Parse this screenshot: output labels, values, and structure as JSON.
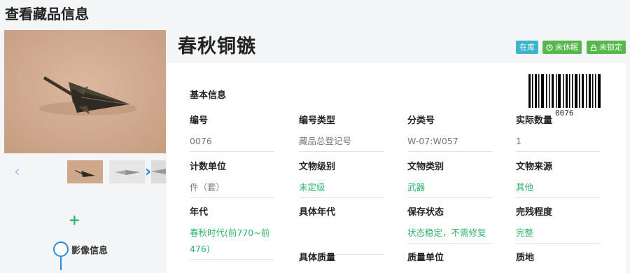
{
  "page": {
    "title": "查看藏品信息"
  },
  "gallery": {
    "prev_icon": "chevron-left-icon",
    "next_icon": "chevron-right-icon",
    "add_icon": "plus-icon",
    "timeline_label": "影像信息"
  },
  "relic": {
    "name": "春秋铜镞",
    "badges": [
      {
        "label": "在库",
        "icon": "",
        "color": "#3bb5c9"
      },
      {
        "label": "未休眠",
        "icon": "clock-icon",
        "color": "#56b84a"
      },
      {
        "label": "未锁定",
        "icon": "lock-icon",
        "color": "#56b84a"
      }
    ]
  },
  "basic_info": {
    "title": "基本信息",
    "barcode_number": "0076",
    "fields": [
      {
        "label": "编号",
        "value": "0076"
      },
      {
        "label": "编号类型",
        "value": "藏品总登记号"
      },
      {
        "label": "分类号",
        "value": "W-07:W057"
      },
      {
        "label": "实际数量",
        "value": "1"
      },
      {
        "label": "计数单位",
        "value": "件（套）"
      },
      {
        "label": "文物级别",
        "value": "未定级"
      },
      {
        "label": "文物类别",
        "value": "武器"
      },
      {
        "label": "文物来源",
        "value": "其他"
      },
      {
        "label": "年代",
        "value": "春秋时代(前770~前476)"
      },
      {
        "label": "具体年代",
        "value": ""
      },
      {
        "label": "保存状态",
        "value": "状态稳定，不需修复"
      },
      {
        "label": "完残程度",
        "value": "完整"
      },
      {
        "label": "具体质量",
        "value": ""
      },
      {
        "label": "质量单位",
        "value": ""
      },
      {
        "label": "质地",
        "value": ""
      }
    ]
  },
  "colors": {
    "accent_green": "#2fb46e",
    "accent_blue": "#2a8bd8"
  }
}
